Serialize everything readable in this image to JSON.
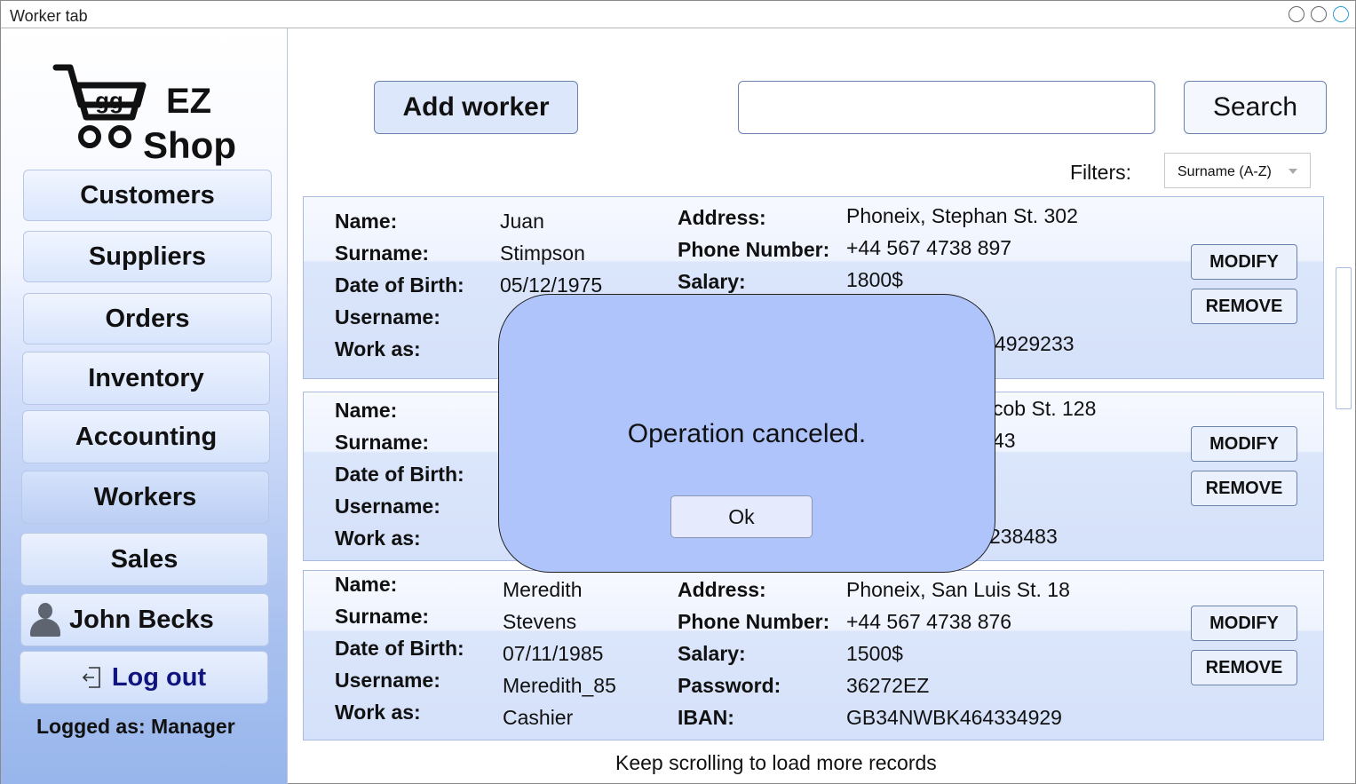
{
  "window": {
    "title": "Worker tab"
  },
  "logo": {
    "cart_text": "gg",
    "line1": "EZ",
    "line2": "Shop"
  },
  "sidebar": {
    "items": [
      {
        "label": "Customers"
      },
      {
        "label": "Suppliers"
      },
      {
        "label": "Orders"
      },
      {
        "label": "Inventory"
      },
      {
        "label": "Accounting"
      },
      {
        "label": "Workers",
        "active": true
      },
      {
        "label": "Sales"
      }
    ],
    "user": {
      "name": "John Becks",
      "icon": "user-icon"
    },
    "logout_label": "Log out",
    "logged_as": "Logged as: Manager"
  },
  "toolbar": {
    "add_label": "Add worker",
    "search_value": "",
    "search_label": "Search",
    "filters_label": "Filters:",
    "filter_selected": "Surname (A-Z)"
  },
  "labels": {
    "name": "Name:",
    "surname": "Surname:",
    "dob": "Date of Birth:",
    "username": "Username:",
    "work_as": "Work as:",
    "address": "Address:",
    "phone": "Phone Number:",
    "salary": "Salary:",
    "password": "Password:",
    "iban": "IBAN:",
    "modify": "MODIFY",
    "remove": "REMOVE"
  },
  "workers": [
    {
      "name": "Juan",
      "surname": "Stimpson",
      "dob": "05/12/1975",
      "address": "Phoneix, Stephan St. 302",
      "phone": "+44 567 4738 897",
      "salary": "1800$",
      "iban_tail": "4929233"
    },
    {
      "address_tail": "cob St. 128",
      "phone_tail": "43",
      "iban_tail": "238483"
    },
    {
      "name": "Meredith",
      "surname": "Stevens",
      "dob": "07/11/1985",
      "username": "Meredith_85",
      "work_as": "Cashier",
      "address": "Phoneix, San Luis St. 18",
      "phone": "+44 567 4738 876",
      "salary": "1500$",
      "password": "36272EZ",
      "iban": "GB34NWBK464334929"
    }
  ],
  "footer": "Keep scrolling to load more records",
  "modal": {
    "message": "Operation canceled.",
    "ok_label": "Ok"
  },
  "colors": {
    "modal_bg": "#aec4fb",
    "accent_text": "#10147e",
    "card_bg": "#dbe6fb"
  }
}
